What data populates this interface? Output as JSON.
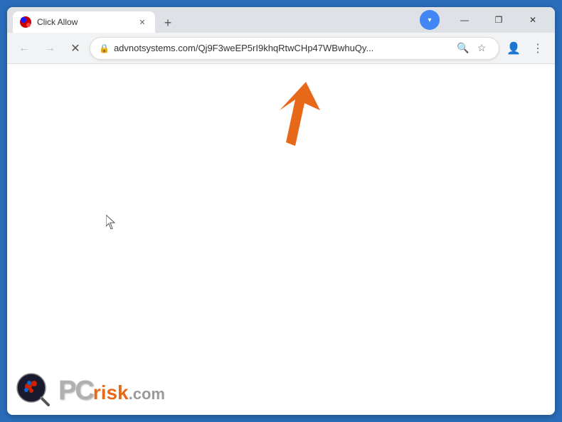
{
  "browser": {
    "tab": {
      "title": "Click Allow",
      "favicon_alt": "page-favicon"
    },
    "window_controls": {
      "minimize": "—",
      "maximize": "❐",
      "close": "✕"
    },
    "new_tab": "+",
    "toolbar": {
      "back_btn": "←",
      "forward_btn": "→",
      "close_btn": "✕",
      "url": "advnotsystems.com/Qj9F3weEP5rI9khqRtwCHp47WBwhuQy...",
      "search_icon": "🔍",
      "bookmark_icon": "☆",
      "profile_icon": "👤",
      "more_icon": "⋮",
      "profile_dropdown": "▾"
    }
  },
  "watermark": {
    "pc_text": "PC",
    "risk_text": "risk",
    "dotcom": ".com"
  },
  "arrow": {
    "color": "#E8681A"
  }
}
